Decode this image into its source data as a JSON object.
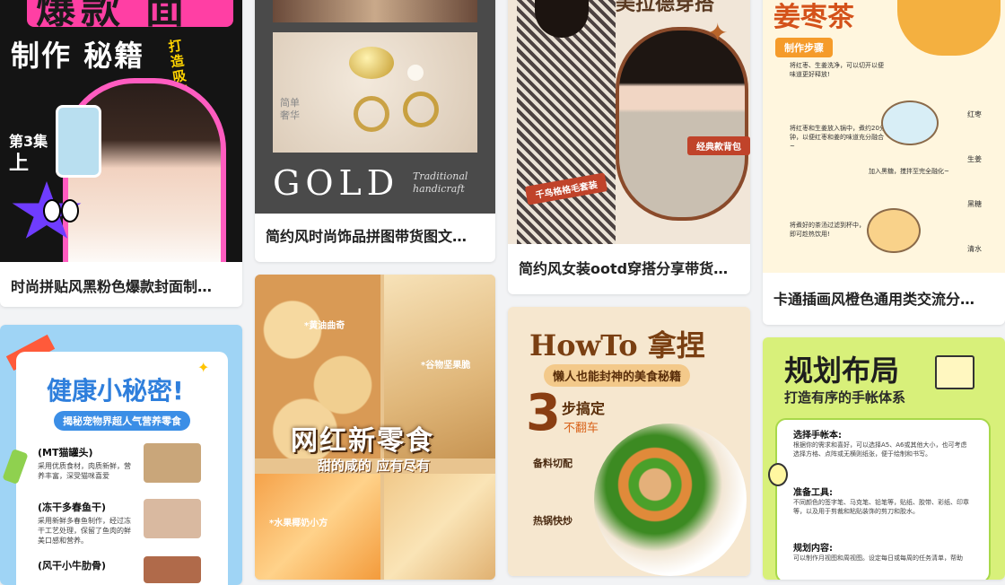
{
  "cards": [
    {
      "title": "时尚拼贴风黑粉色爆款封面制…",
      "thumb": {
        "headline": "爆款 面",
        "subtitle": "制作 秘籍",
        "episode": "第3集",
        "part": "上",
        "tagline": "打造吸睛 流量密码"
      }
    },
    {
      "title": "简约风时尚饰品拼图带货图文…",
      "thumb": {
        "small_text": "简单 奢华",
        "gold": "GOLD",
        "script": "Traditional handicraft"
      }
    },
    {
      "title": "简约风女装ootd穿搭分享带货…",
      "thumb": {
        "header": "美拉德穿搭",
        "tag1": "千鸟格格毛套装",
        "tag2": "经典款背包"
      }
    },
    {
      "title": "卡通插画风橙色通用类交流分…",
      "thumb": {
        "header": "姜枣茶",
        "steps_label": "制作步骤",
        "steps": [
          "将红枣、生姜洗净，可以切开以便味道更好释放!",
          "将红枣和生姜放入锅中，煮约20分钟，以便红枣和姜的味道充分融合~",
          "加入黑糖，搅拌至完全融化~",
          "将煮好的茶汤过滤到杯中，即可趁热饮用!"
        ],
        "ingredients": [
          "红枣",
          "生姜",
          "黑糖",
          "清水"
        ]
      }
    },
    {
      "title": "",
      "thumb": {
        "headline": "健康小秘密!",
        "sub": "揭秘宠物界超人气营养零食",
        "items": [
          {
            "name": "(MT猫罐头)",
            "desc": "采用优质食材，肉质新鲜，营养丰富，深受猫咪喜爱"
          },
          {
            "name": "(冻干多春鱼干)",
            "desc": "采用新鲜多春鱼制作，经过冻干工艺处理，保留了鱼肉的鲜美口感和营养。"
          },
          {
            "name": "(风干小牛肋骨)",
            "desc": ""
          }
        ]
      }
    },
    {
      "title": "",
      "thumb": {
        "label1": "*黄油曲奇",
        "label2": "*谷物坚果脆",
        "headline": "网红新零食",
        "sub": "甜的咸的 应有尽有",
        "label3": "*水果椰奶小方"
      }
    },
    {
      "title": "",
      "thumb": {
        "headline": "HowTo 拿捏",
        "sub": "懒人也能封神的美食秘籍",
        "big": "3",
        "steps": "步搞定",
        "no_fail": "不翻车",
        "step1": "备料切配",
        "step2": "热锅快炒"
      }
    },
    {
      "title": "",
      "thumb": {
        "headline": "规划布局",
        "sub": "打造有序的手帐体系",
        "items": [
          {
            "h": "选择手帐本:",
            "t": "根据你的需求和喜好，可以选择A5、A6或其他大小，也可考虑选择方格、点阵或无横则纸张，便于绘制和书写。"
          },
          {
            "h": "准备工具:",
            "t": "不同颜色的签字笔、马克笔、铅笔等，贴纸、胶带、彩纸、印章等，以及用于剪裁和粘贴装饰的剪刀和胶水。"
          },
          {
            "h": "规划内容:",
            "t": "可以制作月视图和周视图。设定每日或每周的任务清单，帮助"
          }
        ]
      }
    }
  ]
}
